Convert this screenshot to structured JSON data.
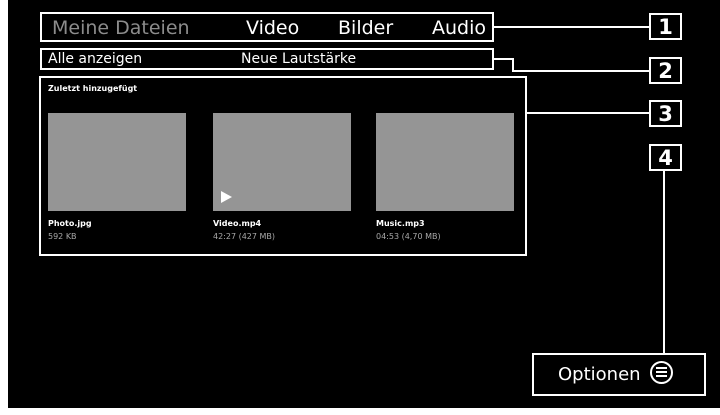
{
  "tabs": {
    "my_files": "Meine Dateien",
    "video": "Video",
    "pictures": "Bilder",
    "audio": "Audio"
  },
  "subbar": {
    "show_all": "Alle anzeigen",
    "new_volume": "Neue Lautstärke"
  },
  "recent": {
    "title": "Zuletzt hinzugefügt",
    "items": [
      {
        "name": "Photo.jpg",
        "meta": "592 KB",
        "icon": "none"
      },
      {
        "name": "Video.mp4",
        "meta": "42:27 (427 MB)",
        "icon": "play-icon"
      },
      {
        "name": "Music.mp3",
        "meta": "04:53 (4,70 MB)",
        "icon": "none"
      }
    ]
  },
  "options": {
    "label": "Optionen",
    "icon": "menu-icon"
  },
  "callouts": [
    "1",
    "2",
    "3",
    "4"
  ],
  "colors": {
    "screen_background": "#000000",
    "tile_placeholder": "#959595",
    "active_text": "#ffffff",
    "inactive_text": "#8c8c8c"
  }
}
